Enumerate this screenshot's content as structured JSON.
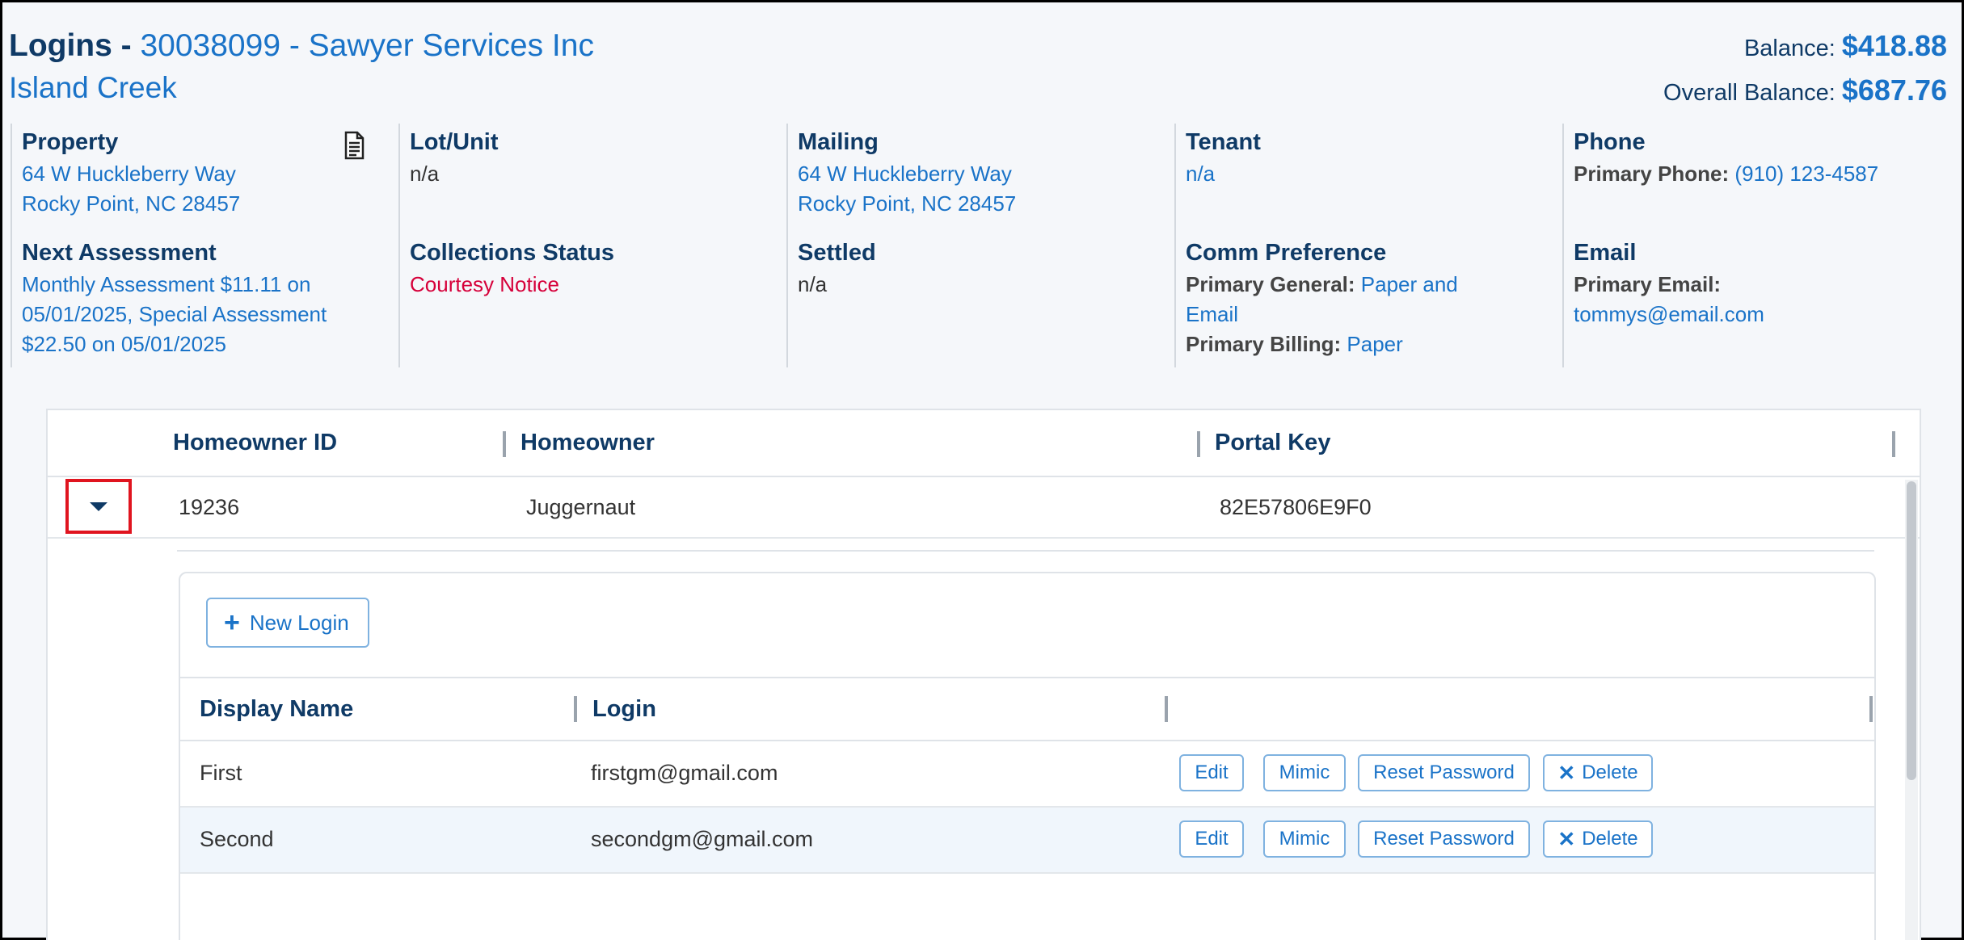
{
  "header": {
    "lead": "Logins - ",
    "account": "30038099 - Sawyer Services Inc",
    "association": "Island Creek"
  },
  "balances": {
    "balance_label": "Balance: ",
    "balance_value": "$418.88",
    "overall_label": "Overall Balance: ",
    "overall_value": "$687.76"
  },
  "info": {
    "property": {
      "title": "Property",
      "line1": "64 W Huckleberry Way",
      "line2": "Rocky Point, NC 28457"
    },
    "lot": {
      "title": "Lot/Unit",
      "value": "n/a"
    },
    "mailing": {
      "title": "Mailing",
      "line1": "64 W Huckleberry Way",
      "line2": "Rocky Point, NC 28457"
    },
    "tenant": {
      "title": "Tenant",
      "value": "n/a"
    },
    "phone": {
      "title": "Phone",
      "label": "Primary Phone: ",
      "value": "(910) 123-4587"
    },
    "next_assessment": {
      "title": "Next Assessment",
      "line1": "Monthly Assessment $11.11 on",
      "line2": "05/01/2025, Special Assessment",
      "line3": "$22.50 on 05/01/2025"
    },
    "collections": {
      "title": "Collections Status",
      "value": "Courtesy Notice"
    },
    "settled": {
      "title": "Settled",
      "value": "n/a"
    },
    "comm": {
      "title": "Comm Preference",
      "general_label": "Primary General: ",
      "general_value1": "Paper and",
      "general_value2": "Email",
      "billing_label": "Primary Billing: ",
      "billing_value": "Paper"
    },
    "email": {
      "title": "Email",
      "label": "Primary Email:",
      "value": "tommys@email.com"
    }
  },
  "table": {
    "columns": [
      "Homeowner ID",
      "Homeowner",
      "Portal Key"
    ],
    "row": {
      "id": "19236",
      "homeowner": "Juggernaut",
      "portal_key": "82E57806E9F0"
    }
  },
  "logins": {
    "new_login_label": "New Login",
    "columns": [
      "Display Name",
      "Login"
    ],
    "rows": [
      {
        "display_name": "First",
        "login": "firstgm@gmail.com"
      },
      {
        "display_name": "Second",
        "login": "secondgm@gmail.com"
      }
    ],
    "actions": {
      "edit": "Edit",
      "mimic": "Mimic",
      "reset": "Reset Password",
      "delete": "Delete"
    }
  }
}
